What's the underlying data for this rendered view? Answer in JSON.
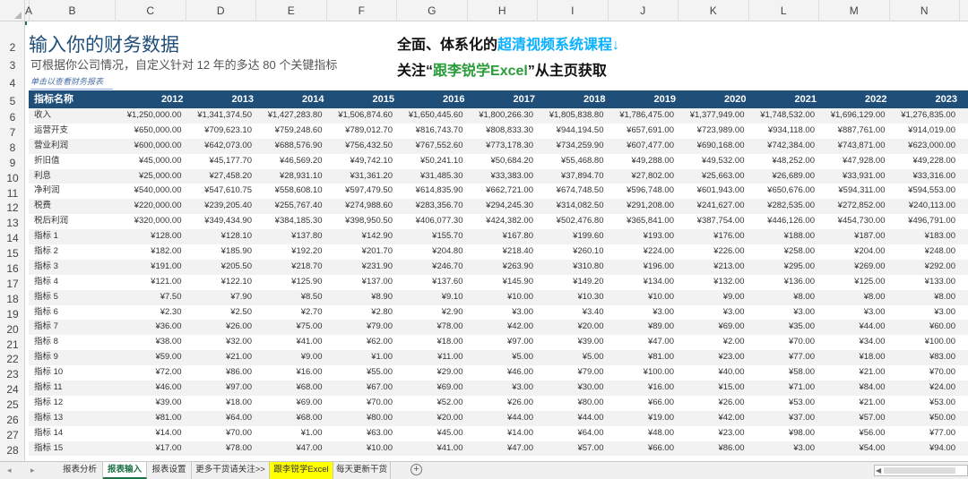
{
  "column_letters": [
    "A",
    "B",
    "C",
    "D",
    "E",
    "F",
    "G",
    "H",
    "I",
    "J",
    "K",
    "L",
    "M",
    "N"
  ],
  "row_numbers": [
    "2",
    "3",
    "4",
    "5",
    "6",
    "7",
    "8",
    "9",
    "10",
    "11",
    "12",
    "13",
    "14",
    "15",
    "16",
    "17",
    "18",
    "19",
    "20",
    "21",
    "22",
    "23",
    "24",
    "25",
    "26",
    "27",
    "28"
  ],
  "header": {
    "title": "输入你的财务数据",
    "subtitle": "可根据你公司情况，自定义针对 12 年的多达 80 个关键指标",
    "hint": "单击以查看财务报表"
  },
  "promo": {
    "line1_pre": "全面、体系化的",
    "line1_hl": "超清视频系统课程",
    "line1_post": "↓",
    "line2_pre": "关注“",
    "line2_hl": "跟李锐学Excel",
    "line2_post": "”从主页获取"
  },
  "table": {
    "label_header": "指标名称",
    "years": [
      "2012",
      "2013",
      "2014",
      "2015",
      "2016",
      "2017",
      "2018",
      "2019",
      "2020",
      "2021",
      "2022",
      "2023"
    ],
    "rows": [
      {
        "label": "收入",
        "values": [
          "¥1,250,000.00",
          "¥1,341,374.50",
          "¥1,427,283.80",
          "¥1,506,874.60",
          "¥1,650,445.60",
          "¥1,800,266.30",
          "¥1,805,838.80",
          "¥1,786,475.00",
          "¥1,377,949.00",
          "¥1,748,532.00",
          "¥1,696,129.00",
          "¥1,276,835.00"
        ]
      },
      {
        "label": "运营开支",
        "values": [
          "¥650,000.00",
          "¥709,623.10",
          "¥759,248.60",
          "¥789,012.70",
          "¥816,743.70",
          "¥808,833.30",
          "¥944,194.50",
          "¥657,691.00",
          "¥723,989.00",
          "¥934,118.00",
          "¥887,761.00",
          "¥914,019.00"
        ]
      },
      {
        "label": "营业利润",
        "values": [
          "¥600,000.00",
          "¥642,073.00",
          "¥688,576.90",
          "¥756,432.50",
          "¥767,552.60",
          "¥773,178.30",
          "¥734,259.90",
          "¥607,477.00",
          "¥690,168.00",
          "¥742,384.00",
          "¥743,871.00",
          "¥623,000.00"
        ]
      },
      {
        "label": "折旧值",
        "values": [
          "¥45,000.00",
          "¥45,177.70",
          "¥46,569.20",
          "¥49,742.10",
          "¥50,241.10",
          "¥50,684.20",
          "¥55,468.80",
          "¥49,288.00",
          "¥49,532.00",
          "¥48,252.00",
          "¥47,928.00",
          "¥49,228.00"
        ]
      },
      {
        "label": "利息",
        "values": [
          "¥25,000.00",
          "¥27,458.20",
          "¥28,931.10",
          "¥31,361.20",
          "¥31,485.30",
          "¥33,383.00",
          "¥37,894.70",
          "¥27,802.00",
          "¥25,663.00",
          "¥26,689.00",
          "¥33,931.00",
          "¥33,316.00"
        ]
      },
      {
        "label": "净利润",
        "values": [
          "¥540,000.00",
          "¥547,610.75",
          "¥558,608.10",
          "¥597,479.50",
          "¥614,835.90",
          "¥662,721.00",
          "¥674,748.50",
          "¥596,748.00",
          "¥601,943.00",
          "¥650,676.00",
          "¥594,311.00",
          "¥594,553.00"
        ]
      },
      {
        "label": "税费",
        "values": [
          "¥220,000.00",
          "¥239,205.40",
          "¥255,767.40",
          "¥274,988.60",
          "¥283,356.70",
          "¥294,245.30",
          "¥314,082.50",
          "¥291,208.00",
          "¥241,627.00",
          "¥282,535.00",
          "¥272,852.00",
          "¥240,113.00"
        ]
      },
      {
        "label": "税后利润",
        "values": [
          "¥320,000.00",
          "¥349,434.90",
          "¥384,185.30",
          "¥398,950.50",
          "¥406,077.30",
          "¥424,382.00",
          "¥502,476.80",
          "¥365,841.00",
          "¥387,754.00",
          "¥446,126.00",
          "¥454,730.00",
          "¥496,791.00"
        ]
      },
      {
        "label": "指标 1",
        "values": [
          "¥128.00",
          "¥128.10",
          "¥137.80",
          "¥142.90",
          "¥155.70",
          "¥167.80",
          "¥199.60",
          "¥193.00",
          "¥176.00",
          "¥188.00",
          "¥187.00",
          "¥183.00"
        ]
      },
      {
        "label": "指标 2",
        "values": [
          "¥182.00",
          "¥185.90",
          "¥192.20",
          "¥201.70",
          "¥204.80",
          "¥218.40",
          "¥260.10",
          "¥224.00",
          "¥226.00",
          "¥258.00",
          "¥204.00",
          "¥248.00"
        ]
      },
      {
        "label": "指标 3",
        "values": [
          "¥191.00",
          "¥205.50",
          "¥218.70",
          "¥231.90",
          "¥246.70",
          "¥263.90",
          "¥310.80",
          "¥196.00",
          "¥213.00",
          "¥295.00",
          "¥269.00",
          "¥292.00"
        ]
      },
      {
        "label": "指标 4",
        "values": [
          "¥121.00",
          "¥122.10",
          "¥125.90",
          "¥137.00",
          "¥137.60",
          "¥145.90",
          "¥149.20",
          "¥134.00",
          "¥132.00",
          "¥136.00",
          "¥125.00",
          "¥133.00"
        ]
      },
      {
        "label": "指标 5",
        "values": [
          "¥7.50",
          "¥7.90",
          "¥8.50",
          "¥8.90",
          "¥9.10",
          "¥10.00",
          "¥10.30",
          "¥10.00",
          "¥9.00",
          "¥8.00",
          "¥8.00",
          "¥8.00"
        ]
      },
      {
        "label": "指标 6",
        "values": [
          "¥2.30",
          "¥2.50",
          "¥2.70",
          "¥2.80",
          "¥2.90",
          "¥3.00",
          "¥3.40",
          "¥3.00",
          "¥3.00",
          "¥3.00",
          "¥3.00",
          "¥3.00"
        ]
      },
      {
        "label": "指标 7",
        "values": [
          "¥36.00",
          "¥26.00",
          "¥75.00",
          "¥79.00",
          "¥78.00",
          "¥42.00",
          "¥20.00",
          "¥89.00",
          "¥69.00",
          "¥35.00",
          "¥44.00",
          "¥60.00"
        ]
      },
      {
        "label": "指标 8",
        "values": [
          "¥38.00",
          "¥32.00",
          "¥41.00",
          "¥62.00",
          "¥18.00",
          "¥97.00",
          "¥39.00",
          "¥47.00",
          "¥2.00",
          "¥70.00",
          "¥34.00",
          "¥100.00"
        ]
      },
      {
        "label": "指标 9",
        "values": [
          "¥59.00",
          "¥21.00",
          "¥9.00",
          "¥1.00",
          "¥11.00",
          "¥5.00",
          "¥5.00",
          "¥81.00",
          "¥23.00",
          "¥77.00",
          "¥18.00",
          "¥83.00"
        ]
      },
      {
        "label": "指标 10",
        "values": [
          "¥72.00",
          "¥86.00",
          "¥16.00",
          "¥55.00",
          "¥29.00",
          "¥46.00",
          "¥79.00",
          "¥100.00",
          "¥40.00",
          "¥58.00",
          "¥21.00",
          "¥70.00"
        ]
      },
      {
        "label": "指标 11",
        "values": [
          "¥46.00",
          "¥97.00",
          "¥68.00",
          "¥67.00",
          "¥69.00",
          "¥3.00",
          "¥30.00",
          "¥16.00",
          "¥15.00",
          "¥71.00",
          "¥84.00",
          "¥24.00"
        ]
      },
      {
        "label": "指标 12",
        "values": [
          "¥39.00",
          "¥18.00",
          "¥69.00",
          "¥70.00",
          "¥52.00",
          "¥26.00",
          "¥80.00",
          "¥66.00",
          "¥26.00",
          "¥53.00",
          "¥21.00",
          "¥53.00"
        ]
      },
      {
        "label": "指标 13",
        "values": [
          "¥81.00",
          "¥64.00",
          "¥68.00",
          "¥80.00",
          "¥20.00",
          "¥44.00",
          "¥44.00",
          "¥19.00",
          "¥42.00",
          "¥37.00",
          "¥57.00",
          "¥50.00"
        ]
      },
      {
        "label": "指标 14",
        "values": [
          "¥14.00",
          "¥70.00",
          "¥1.00",
          "¥63.00",
          "¥45.00",
          "¥14.00",
          "¥64.00",
          "¥48.00",
          "¥23.00",
          "¥98.00",
          "¥56.00",
          "¥77.00"
        ]
      },
      {
        "label": "指标 15",
        "values": [
          "¥17.00",
          "¥78.00",
          "¥47.00",
          "¥10.00",
          "¥41.00",
          "¥47.00",
          "¥57.00",
          "¥66.00",
          "¥86.00",
          "¥3.00",
          "¥54.00",
          "¥94.00"
        ]
      }
    ]
  },
  "sheet_tabs": [
    {
      "label": "报表分析",
      "active": false,
      "yellow": false
    },
    {
      "label": "报表输入",
      "active": true,
      "yellow": false
    },
    {
      "label": "报表设置",
      "active": false,
      "yellow": false
    },
    {
      "label": "更多干货请关注>>",
      "active": false,
      "yellow": false
    },
    {
      "label": "跟李锐学Excel",
      "active": false,
      "yellow": true
    },
    {
      "label": "每天更新干货",
      "active": false,
      "yellow": false
    }
  ],
  "icons": {
    "prev_sheet": "◂",
    "next_sheet": "▸",
    "add_sheet": "+",
    "scroll_left": "◀"
  },
  "colors": {
    "header_bg": "#1f4e79",
    "title": "#1f4e79",
    "promo_blue": "#0bb0ff",
    "promo_green": "#2a9d3a",
    "active_tab": "#1e7145",
    "yellow_tab": "#ffff00"
  }
}
